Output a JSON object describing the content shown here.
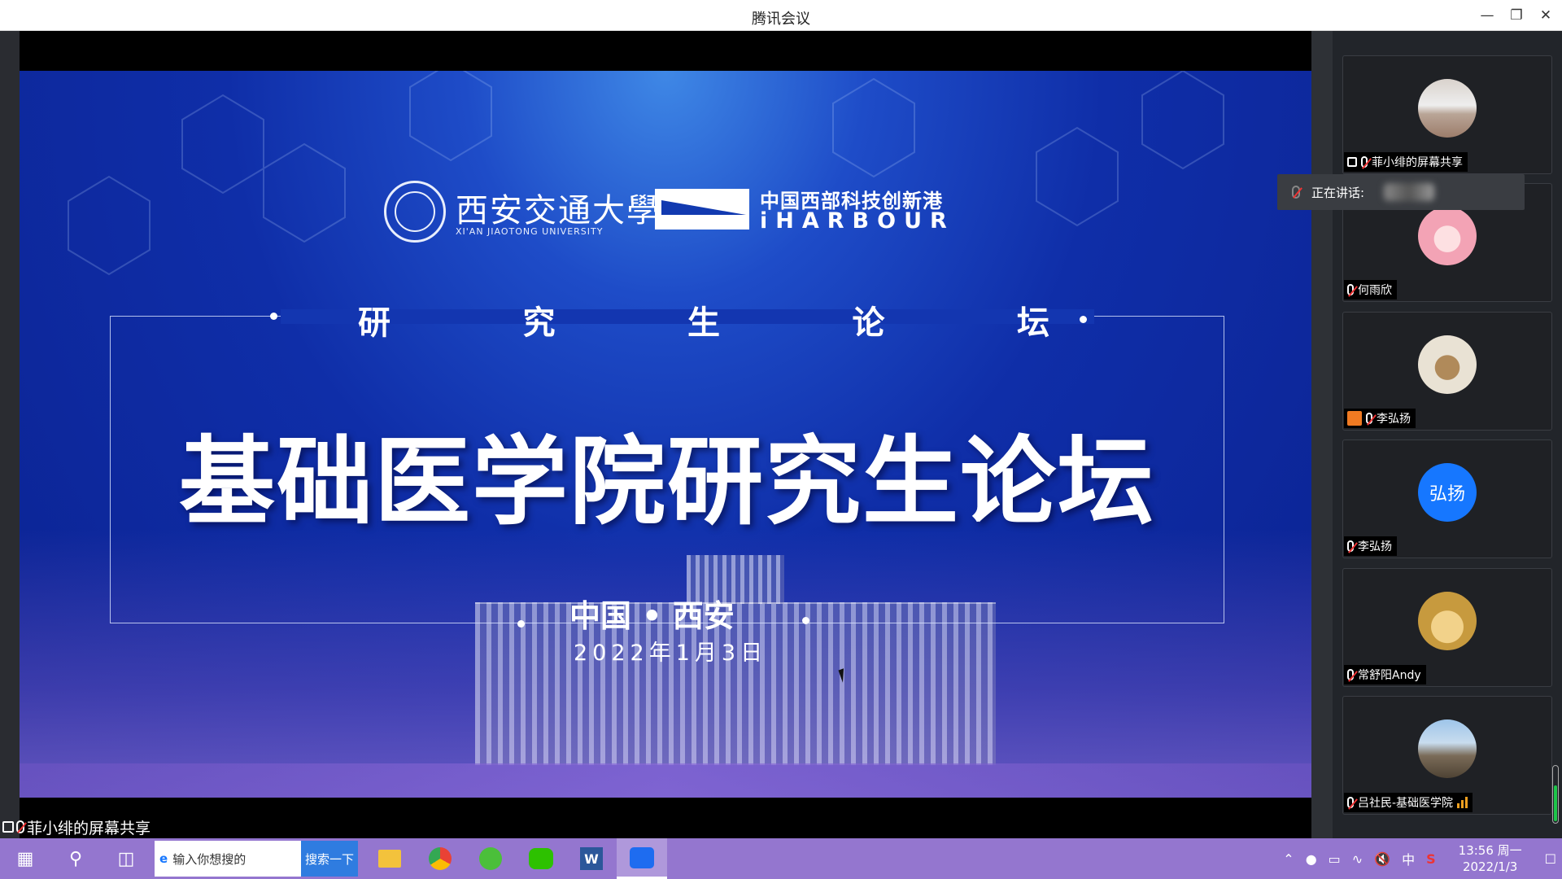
{
  "window": {
    "title": "腾讯会议"
  },
  "slide": {
    "university_cn": "西安交通大學",
    "university_en": "XI'AN JIAOTONG UNIVERSITY",
    "partner_cn": "中国西部科技创新港",
    "partner_en": "iHARBOUR",
    "forum_chars": [
      "研",
      "究",
      "生",
      "论",
      "坛"
    ],
    "headline": "基础医学院研究生论坛",
    "city": "中国 • 西安",
    "date": "2022年1月3日"
  },
  "share_label": "菲小绯的屏幕共享",
  "speaking_label": "正在讲话:",
  "participants": [
    {
      "name": "菲小绯的屏幕共享",
      "avatar": "photo-person-beach"
    },
    {
      "name": "何雨欣",
      "avatar": "anime-pink"
    },
    {
      "name": "李弘扬",
      "avatar": "photo-box"
    },
    {
      "name": "李弘扬",
      "avatar": "text-avatar",
      "initials": "弘扬"
    },
    {
      "name": "常舒阳Andy",
      "avatar": "photo-dog"
    },
    {
      "name": "吕社民-基础医学院",
      "avatar": "photo-mountain"
    }
  ],
  "taskbar": {
    "search_placeholder": "输入你想搜的",
    "search_button": "搜索一下",
    "ime": "中",
    "time": "13:56 周一",
    "date": "2022/1/3"
  },
  "colors": {
    "slide_blue": "#1336b0",
    "taskbar": "#9476cf",
    "accent_green": "#1ec54a",
    "avatar_blue": "#1677ff"
  }
}
